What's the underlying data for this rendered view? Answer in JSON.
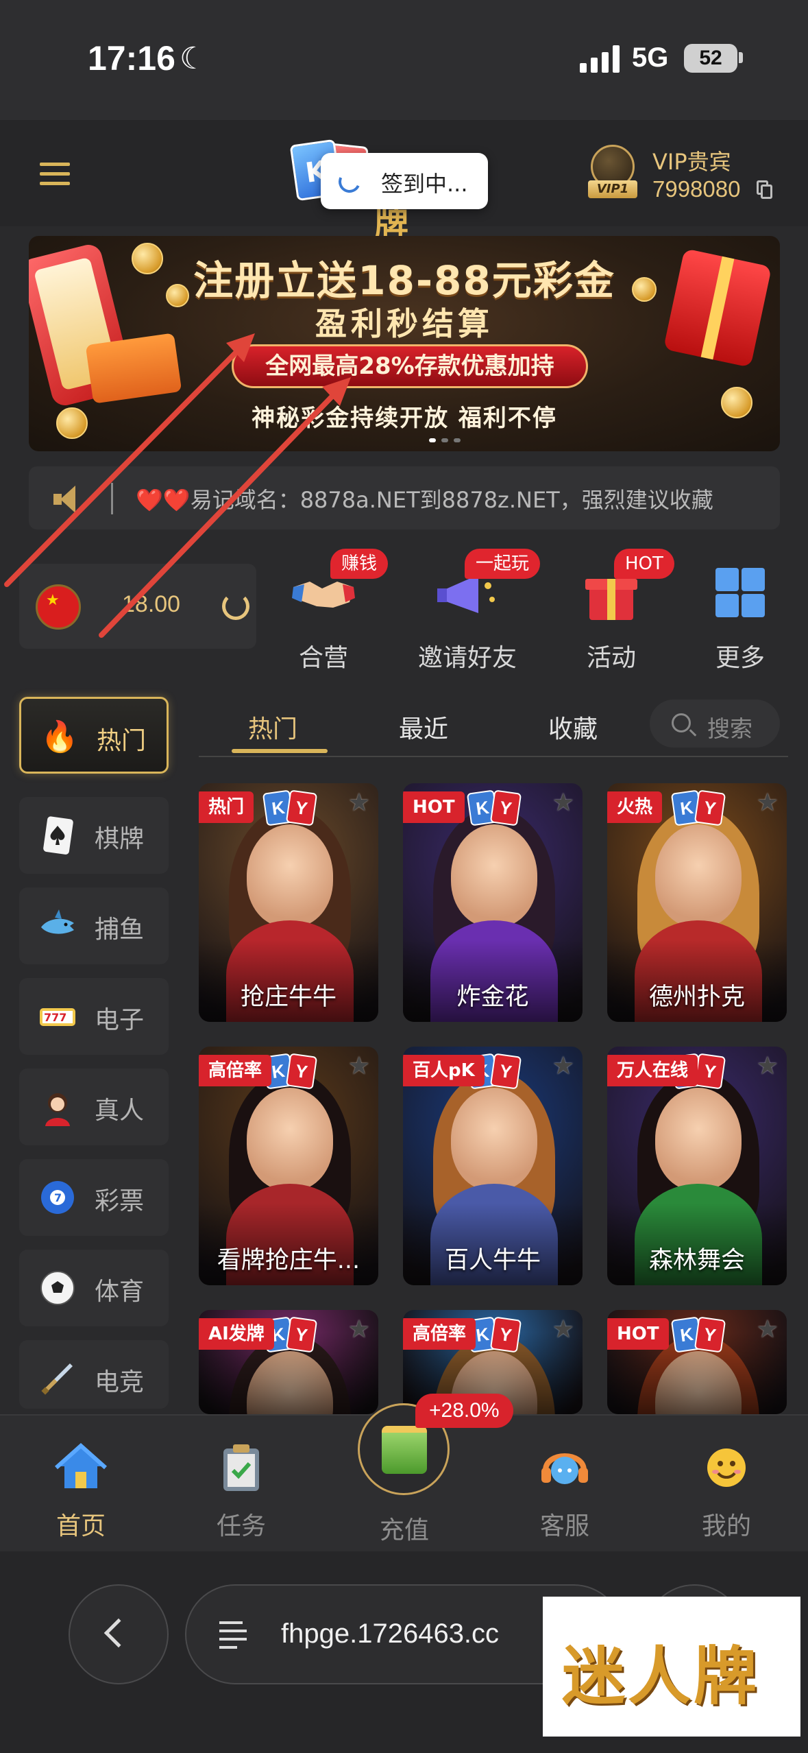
{
  "status_bar": {
    "time": "17:16",
    "network": "5G",
    "battery": "52"
  },
  "header": {
    "logo_letter": "K",
    "logo_text": "开元棋牌",
    "toast": "签到中...",
    "vip_title": "VIP贵宾",
    "vip_id": "7998080",
    "vip_rank": "VIP1"
  },
  "banner": {
    "title": "注册立送18-88元彩金",
    "subtitle": "盈利秒结算",
    "pill": "全网最高28%存款优惠加持",
    "footer": "神秘彩金持续开放  福利不停"
  },
  "marquee": {
    "hearts": "❤️❤️",
    "text": "易记域名：8878a.NET到8878z.NET，强烈建议收藏"
  },
  "balance": {
    "value": "18.00"
  },
  "quick_nav": [
    {
      "label": "合营",
      "badge": "赚钱",
      "icon": "handshake-icon"
    },
    {
      "label": "邀请好友",
      "badge": "一起玩",
      "icon": "megaphone-icon"
    },
    {
      "label": "活动",
      "badge": "HOT",
      "icon": "gift-icon"
    },
    {
      "label": "更多",
      "badge": "",
      "icon": "grid-icon"
    }
  ],
  "sidebar": [
    {
      "label": "热门",
      "icon": "fire-icon",
      "active": true
    },
    {
      "label": "棋牌",
      "icon": "spade-card-icon"
    },
    {
      "label": "捕鱼",
      "icon": "shark-icon"
    },
    {
      "label": "电子",
      "icon": "slot-777-icon"
    },
    {
      "label": "真人",
      "icon": "dealer-icon"
    },
    {
      "label": "彩票",
      "icon": "lottery-ball-icon"
    },
    {
      "label": "体育",
      "icon": "soccer-ball-icon"
    },
    {
      "label": "电竞",
      "icon": "sword-icon"
    }
  ],
  "tabs": [
    {
      "label": "热门",
      "active": true
    },
    {
      "label": "最近"
    },
    {
      "label": "收藏"
    }
  ],
  "search": {
    "placeholder": "搜索"
  },
  "games": [
    {
      "name": "抢庄牛牛",
      "tag": "热门",
      "hair": "#4a2a1a",
      "body": "#b8262c",
      "bg": "#6a4a2a"
    },
    {
      "name": "炸金花",
      "tag": "HOT",
      "hair": "#2a1a2a",
      "body": "#6a2fb0",
      "bg": "#3a2a6a"
    },
    {
      "name": "德州扑克",
      "tag": "火热",
      "hair": "#c88a3a",
      "body": "#b82a2a",
      "bg": "#7a4a1a"
    },
    {
      "name": "看牌抢庄牛...",
      "tag": "高倍率",
      "hair": "#1a1010",
      "body": "#a8262a",
      "bg": "#5a3a1a"
    },
    {
      "name": "百人牛牛",
      "tag": "百人pK",
      "hair": "#a8622a",
      "body": "#4a5aa8",
      "bg": "#1a3a7a"
    },
    {
      "name": "森林舞会",
      "tag": "万人在线",
      "hair": "#1a1010",
      "body": "#2a8a3a",
      "bg": "#3a2a6a"
    },
    {
      "name": "",
      "tag": "AI发牌",
      "hair": "#2a1a1a",
      "body": "#c83a7a",
      "bg": "#7a2a6a"
    },
    {
      "name": "",
      "tag": "高倍率",
      "hair": "#8a5a2a",
      "body": "#3a8ad8",
      "bg": "#2a6aa8"
    },
    {
      "name": "",
      "tag": "HOT",
      "hair": "#9a3a1a",
      "body": "#c82a2a",
      "bg": "#6a2a1a"
    }
  ],
  "bottom_nav": [
    {
      "label": "首页",
      "icon": "home-icon",
      "active": true
    },
    {
      "label": "任务",
      "icon": "clipboard-icon"
    },
    {
      "label": "充值",
      "icon": "cash-machine-icon"
    },
    {
      "label": "客服",
      "icon": "headset-icon"
    },
    {
      "label": "我的",
      "icon": "smiley-icon"
    }
  ],
  "bonus_badge": "+28.0%",
  "browser": {
    "url": "fhpge.1726463.cc"
  },
  "watermark": "迷人牌",
  "colors": {
    "gold": "#e7c57d",
    "red_badge": "#d8232c",
    "bg": "#2a2a2c",
    "arrow": "#e0453a"
  }
}
